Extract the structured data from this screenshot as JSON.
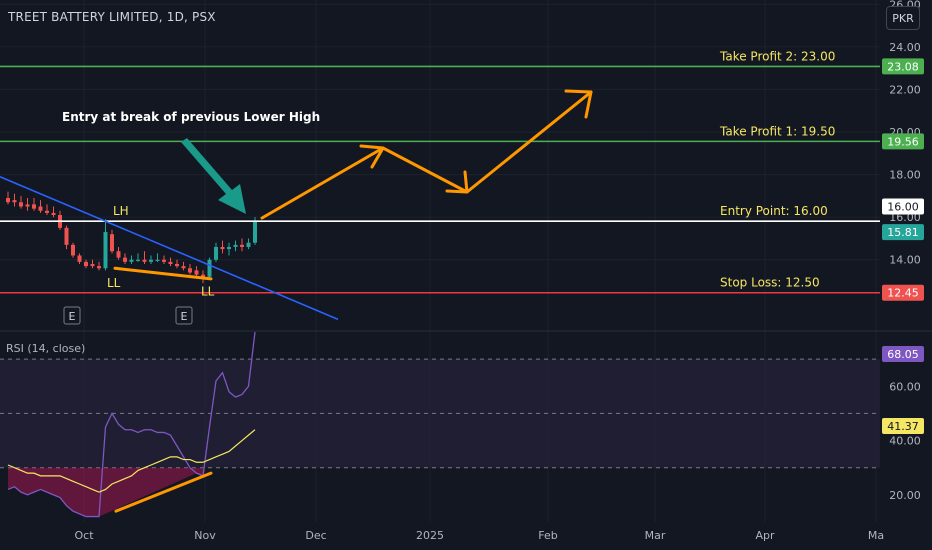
{
  "header": {
    "symbol_title": "TREET BATTERY LIMITED, 1D, PSX",
    "currency_label": "PKR"
  },
  "rsi_panel": {
    "label": "RSI (14, close)"
  },
  "colors": {
    "background": "#131722",
    "grid": "#2a2e39",
    "text": "#b2b5be",
    "up_candle": "#26a69a",
    "down_candle": "#ef5350",
    "take_profit_line": "#4caf50",
    "entry_line": "#ffffff",
    "stop_loss_line": "#f23645",
    "trendline": "#2962ff",
    "annotation": "#ff9800",
    "level_text": "#f5e663",
    "pointer_arrow": "#1a9a8a",
    "rsi_line": "#7e57c2",
    "rsi_ma": "#f5e663",
    "rsi_fill": "#2a2440"
  },
  "chart_data": [
    {
      "type": "candlestick",
      "title": "TREET BATTERY LIMITED, 1D, PSX",
      "currency": "PKR",
      "x_ticks": [
        "Oct",
        "Nov",
        "Dec",
        "2025",
        "Feb",
        "Mar",
        "Apr",
        "Ma"
      ],
      "y_ticks": [
        14.0,
        16.0,
        18.0,
        20.0,
        22.0,
        24.0,
        26.0
      ],
      "y_range": [
        10.7,
        26.2
      ],
      "grid": true,
      "candles": [
        {
          "o": 16.9,
          "h": 17.2,
          "l": 16.6,
          "c": 16.7
        },
        {
          "o": 16.8,
          "h": 17.1,
          "l": 16.5,
          "c": 16.7
        },
        {
          "o": 16.7,
          "h": 17.0,
          "l": 16.4,
          "c": 16.5
        },
        {
          "o": 16.6,
          "h": 16.9,
          "l": 16.3,
          "c": 16.5
        },
        {
          "o": 16.6,
          "h": 16.9,
          "l": 16.3,
          "c": 16.4
        },
        {
          "o": 16.5,
          "h": 16.8,
          "l": 16.2,
          "c": 16.3
        },
        {
          "o": 16.3,
          "h": 16.6,
          "l": 16.1,
          "c": 16.2
        },
        {
          "o": 16.2,
          "h": 16.5,
          "l": 16.0,
          "c": 16.1
        },
        {
          "o": 16.1,
          "h": 16.3,
          "l": 15.4,
          "c": 15.5
        },
        {
          "o": 15.5,
          "h": 15.6,
          "l": 14.5,
          "c": 14.7
        },
        {
          "o": 14.7,
          "h": 14.8,
          "l": 14.1,
          "c": 14.2
        },
        {
          "o": 14.2,
          "h": 14.3,
          "l": 13.8,
          "c": 13.9
        },
        {
          "o": 13.9,
          "h": 14.0,
          "l": 13.6,
          "c": 13.7
        },
        {
          "o": 13.8,
          "h": 14.0,
          "l": 13.6,
          "c": 13.7
        },
        {
          "o": 13.7,
          "h": 13.9,
          "l": 13.5,
          "c": 13.6
        },
        {
          "o": 13.6,
          "h": 15.9,
          "l": 13.5,
          "c": 15.3
        },
        {
          "o": 15.2,
          "h": 15.4,
          "l": 14.3,
          "c": 14.4
        },
        {
          "o": 14.4,
          "h": 14.6,
          "l": 14.0,
          "c": 14.1
        },
        {
          "o": 14.1,
          "h": 14.3,
          "l": 13.8,
          "c": 13.9
        },
        {
          "o": 13.9,
          "h": 14.2,
          "l": 13.8,
          "c": 14.0
        },
        {
          "o": 14.0,
          "h": 14.3,
          "l": 13.9,
          "c": 14.0
        },
        {
          "o": 14.0,
          "h": 14.4,
          "l": 13.8,
          "c": 13.9
        },
        {
          "o": 13.9,
          "h": 14.2,
          "l": 13.8,
          "c": 14.0
        },
        {
          "o": 14.0,
          "h": 14.3,
          "l": 13.9,
          "c": 14.0
        },
        {
          "o": 14.0,
          "h": 14.2,
          "l": 13.8,
          "c": 13.9
        },
        {
          "o": 13.9,
          "h": 14.1,
          "l": 13.7,
          "c": 13.8
        },
        {
          "o": 13.8,
          "h": 14.0,
          "l": 13.6,
          "c": 13.7
        },
        {
          "o": 13.7,
          "h": 13.9,
          "l": 13.5,
          "c": 13.6
        },
        {
          "o": 13.6,
          "h": 13.8,
          "l": 13.3,
          "c": 13.4
        },
        {
          "o": 13.5,
          "h": 13.7,
          "l": 13.2,
          "c": 13.3
        },
        {
          "o": 13.3,
          "h": 13.5,
          "l": 12.9,
          "c": 13.1
        },
        {
          "o": 13.2,
          "h": 14.1,
          "l": 13.1,
          "c": 14.0
        },
        {
          "o": 14.0,
          "h": 14.8,
          "l": 13.9,
          "c": 14.6
        },
        {
          "o": 14.6,
          "h": 14.9,
          "l": 14.3,
          "c": 14.5
        },
        {
          "o": 14.5,
          "h": 14.8,
          "l": 14.2,
          "c": 14.6
        },
        {
          "o": 14.6,
          "h": 14.9,
          "l": 14.4,
          "c": 14.7
        },
        {
          "o": 14.7,
          "h": 15.0,
          "l": 14.4,
          "c": 14.6
        },
        {
          "o": 14.6,
          "h": 15.0,
          "l": 14.5,
          "c": 14.8
        },
        {
          "o": 14.8,
          "h": 16.0,
          "l": 14.7,
          "c": 15.8
        }
      ],
      "levels": [
        {
          "name": "take-profit-2",
          "price": 23.08,
          "label": "Take Profit 2: 23.00",
          "axis_label": "23.08",
          "color": "#4caf50"
        },
        {
          "name": "take-profit-1",
          "price": 19.56,
          "label": "Take Profit 1: 19.50",
          "axis_label": "19.56",
          "color": "#4caf50"
        },
        {
          "name": "entry-point",
          "price": 15.81,
          "label": "Entry Point: 16.00",
          "axis_label": "16.00",
          "color": "#ffffff"
        },
        {
          "name": "stop-loss",
          "price": 12.45,
          "label": "Stop Loss: 12.50",
          "axis_label": "12.45",
          "color": "#f23645"
        }
      ],
      "last_price_label": "15.81",
      "annotations": {
        "entry_note": "Entry at break of previous Lower High",
        "swing_labels": [
          "LH",
          "LL",
          "LL"
        ],
        "earnings_markers": [
          "E",
          "E"
        ]
      }
    },
    {
      "type": "line",
      "title": "RSI (14, close)",
      "y_ticks": [
        20.0,
        40.0,
        60.0
      ],
      "y_range": [
        10,
        80
      ],
      "bands": [
        30,
        50,
        70
      ],
      "grid": true,
      "series": [
        {
          "name": "RSI",
          "values": [
            22,
            23,
            21,
            20,
            21,
            22,
            21,
            20,
            19,
            16,
            14,
            13,
            12,
            12,
            12,
            45,
            50,
            46,
            44,
            44,
            43,
            44,
            44,
            43,
            43,
            42,
            38,
            34,
            30,
            28,
            27,
            45,
            62,
            65,
            58,
            56,
            57,
            60,
            80
          ],
          "last_label": "68.05"
        },
        {
          "name": "RSI-based MA",
          "values": [
            31,
            30,
            29,
            28,
            28,
            27,
            27,
            27,
            27,
            26,
            25,
            24,
            23,
            22,
            21,
            22,
            24,
            25,
            26,
            27,
            29,
            30,
            31,
            32,
            33,
            34,
            34,
            33,
            33,
            32,
            32,
            33,
            34,
            35,
            36,
            38,
            40,
            42,
            44
          ],
          "last_label": "41.37"
        }
      ]
    }
  ]
}
